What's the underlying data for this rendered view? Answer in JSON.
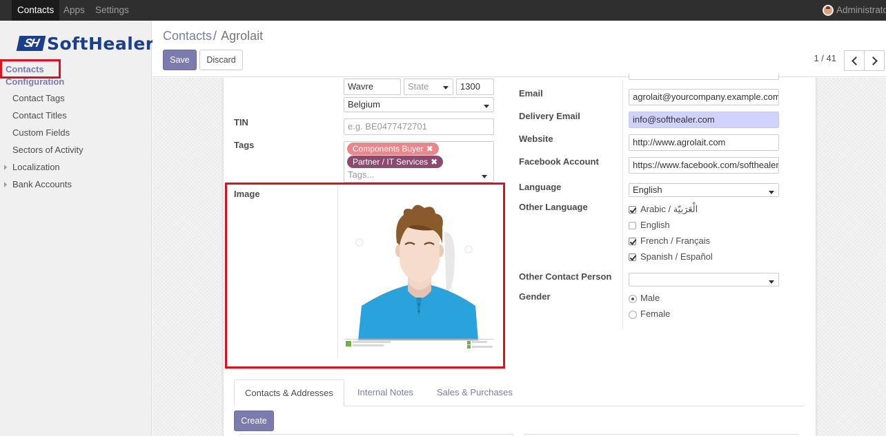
{
  "topnav": {
    "items": [
      "Contacts",
      "Apps",
      "Settings"
    ],
    "user": "Administrator"
  },
  "sidebar": {
    "logo_mark": "SH",
    "logo_text": "SoftHealer",
    "contacts": "Contacts",
    "configuration": "Configuration",
    "items": [
      "Contact Tags",
      "Contact Titles",
      "Custom Fields",
      "Sectors of Activity",
      "Localization",
      "Bank Accounts"
    ]
  },
  "control_panel": {
    "breadcrumb_parent": "Contacts",
    "breadcrumb_sep": "/",
    "breadcrumb_current": "Agrolait",
    "save": "Save",
    "discard": "Discard",
    "pager": "1 / 41"
  },
  "form": {
    "city": "Wavre",
    "state_placeholder": "State",
    "zip": "1300",
    "country": "Belgium",
    "tin_label": "TIN",
    "tin_placeholder": "e.g. BE0477472701",
    "tags_label": "Tags",
    "tags": [
      {
        "name": "Components Buyer",
        "color": "#e9878a"
      },
      {
        "name": "Partner / IT Services",
        "color": "#8c4b6e"
      }
    ],
    "tags_placeholder": "Tags...",
    "image_label": "Image",
    "image_credit_left": "Download from Dreamstime.com",
    "email_label": "Email",
    "email": "agrolait@yourcompany.example.com",
    "delivery_email_label": "Delivery Email",
    "delivery_email": "info@softhealer.com",
    "website_label": "Website",
    "website": "http://www.agrolait.com",
    "facebook_label": "Facebook Account",
    "facebook": "https://www.facebook.com/softhealer",
    "language_label": "Language",
    "language": "English",
    "other_language_label": "Other Language",
    "other_languages": [
      {
        "label": "Arabic / الْعَرَبيّة",
        "checked": true
      },
      {
        "label": "English",
        "checked": false
      },
      {
        "label": "French / Français",
        "checked": true
      },
      {
        "label": "Spanish / Español",
        "checked": true
      }
    ],
    "other_contact_label": "Other Contact Person",
    "gender_label": "Gender",
    "genders": [
      {
        "label": "Male",
        "checked": true
      },
      {
        "label": "Female",
        "checked": false
      }
    ]
  },
  "tabs": [
    "Contacts & Addresses",
    "Internal Notes",
    "Sales & Purchases"
  ],
  "create_button": "Create",
  "colors": {
    "accent": "#7c7bad",
    "highlight_red": "#e2101c",
    "topbar": "#2f2f2f",
    "shirt": "#2aa3dc"
  }
}
